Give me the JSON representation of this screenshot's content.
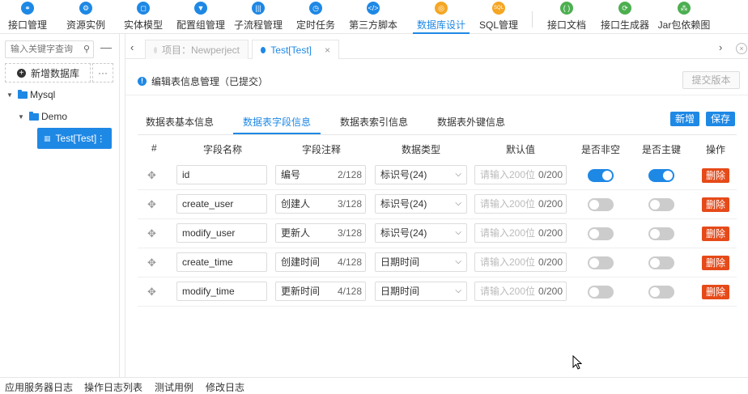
{
  "nav": {
    "items": [
      {
        "label": "接口管理",
        "icon": "link-icon",
        "color": "#1e88e5"
      },
      {
        "label": "资源实例",
        "icon": "gear-icon",
        "color": "#1e88e5"
      },
      {
        "label": "实体模型",
        "icon": "crop-icon",
        "color": "#1e88e5"
      },
      {
        "label": "配置组管理",
        "icon": "filter-icon",
        "color": "#1e88e5"
      },
      {
        "label": "子流程管理",
        "icon": "bars-icon",
        "color": "#1e88e5"
      },
      {
        "label": "定时任务",
        "icon": "clock-icon",
        "color": "#1e88e5"
      },
      {
        "label": "第三方脚本",
        "icon": "code-icon",
        "color": "#1e88e5"
      },
      {
        "label": "数据库设计",
        "icon": "database-icon",
        "color": "#f5a623"
      },
      {
        "label": "SQL管理",
        "icon": "sql-icon",
        "color": "#f5a623"
      },
      {
        "label": "接口文档",
        "icon": "doc-icon",
        "color": "#4caf50"
      },
      {
        "label": "接口生成器",
        "icon": "generator-icon",
        "color": "#4caf50"
      },
      {
        "label": "Jar包依赖图",
        "icon": "dependency-icon",
        "color": "#4caf50"
      }
    ],
    "active_index": 7
  },
  "sidebar": {
    "search_placeholder": "输入关键字查询",
    "add_db_label": "新增数据库",
    "more_label": "···",
    "tree": {
      "root": "Mysql",
      "child": "Demo",
      "selected": "Test[Test]"
    }
  },
  "tabs": [
    {
      "label": "项目：Newperject",
      "active": false
    },
    {
      "label": "Test[Test]",
      "active": true
    }
  ],
  "header": {
    "title": "编辑表信息管理（已提交）",
    "submit_label": "提交版本"
  },
  "subtabs": [
    "数据表基本信息",
    "数据表字段信息",
    "数据表索引信息",
    "数据表外键信息"
  ],
  "active_subtab": 1,
  "actions": {
    "add": "新增",
    "save": "保存"
  },
  "columns": [
    "#",
    "字段名称",
    "字段注释",
    "数据类型",
    "默认值",
    "是否非空",
    "是否主键",
    "操作"
  ],
  "default_placeholder": "请输入200位",
  "delete_label": "删除",
  "rows": [
    {
      "name": "id",
      "comment": "编号",
      "comment_count": "2/128",
      "type": "标识号(24)",
      "default_count": "0/200",
      "not_null": true,
      "primary_key": true
    },
    {
      "name": "create_user",
      "comment": "创建人",
      "comment_count": "3/128",
      "type": "标识号(24)",
      "default_count": "0/200",
      "not_null": false,
      "primary_key": false
    },
    {
      "name": "modify_user",
      "comment": "更新人",
      "comment_count": "3/128",
      "type": "标识号(24)",
      "default_count": "0/200",
      "not_null": false,
      "primary_key": false
    },
    {
      "name": "create_time",
      "comment": "创建时间",
      "comment_count": "4/128",
      "type": "日期时间",
      "default_count": "0/200",
      "not_null": false,
      "primary_key": false
    },
    {
      "name": "modify_time",
      "comment": "更新时间",
      "comment_count": "4/128",
      "type": "日期时间",
      "default_count": "0/200",
      "not_null": false,
      "primary_key": false
    }
  ],
  "bottom": [
    "应用服务器日志",
    "操作日志列表",
    "测试用例",
    "修改日志"
  ]
}
